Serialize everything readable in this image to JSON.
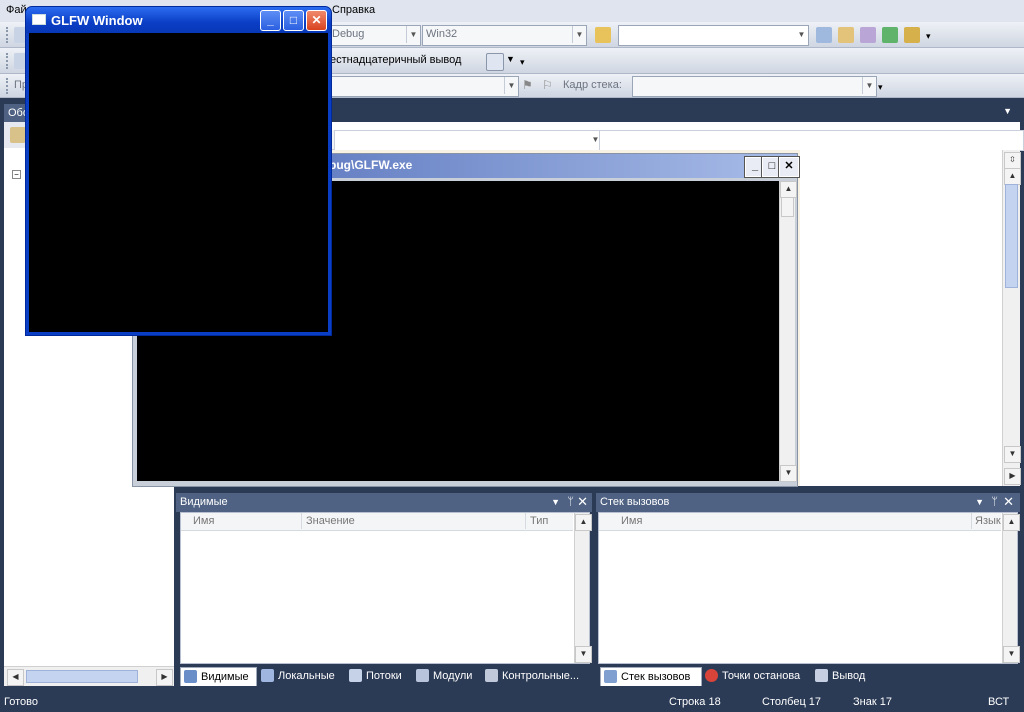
{
  "menubar": {
    "items": [
      "Фай",
      "Справка"
    ]
  },
  "toolbar1": {
    "config": "Debug",
    "platform": "Win32",
    "search_value": ""
  },
  "toolbar2": {
    "hex_label": "естнадцатеричный вывод"
  },
  "toolbar3": {
    "process_label": "Пр",
    "stack_frame_label": "Кадр стека:",
    "stack_frame_value": ""
  },
  "left_panel": {
    "title": "Обо"
  },
  "console": {
    "title": "bug\\GLFW.exe"
  },
  "glfw_window": {
    "title": "GLFW Window"
  },
  "watch_panel": {
    "title": "Видимые",
    "columns": [
      "Имя",
      "Значение",
      "Тип"
    ]
  },
  "callstack_panel": {
    "title": "Стек вызовов",
    "columns": [
      "Имя",
      "Язык"
    ]
  },
  "bottom_tabs_left": [
    "Видимые",
    "Локальные",
    "Потоки",
    "Модули",
    "Контрольные..."
  ],
  "bottom_tabs_right": [
    "Стек вызовов",
    "Точки останова",
    "Вывод"
  ],
  "status": {
    "ready": "Готово",
    "row": "Строка 18",
    "col": "Столбец 17",
    "char": "Знак 17",
    "mode": "ВСТ"
  },
  "colors": {
    "ide_dark": "#2b3a55",
    "xp_blue": "#0a3ec5",
    "console_bg": "#000000"
  }
}
